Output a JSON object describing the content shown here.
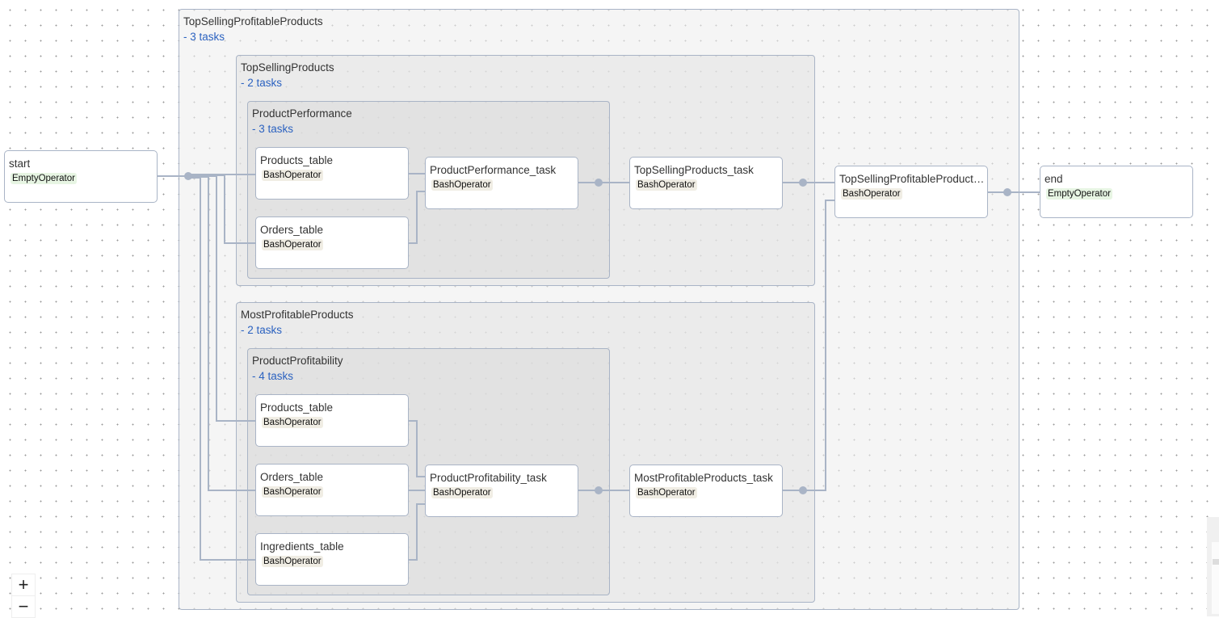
{
  "groups": {
    "top_selling_profitable": {
      "title": "TopSellingProfitableProducts",
      "count": "- 3 tasks"
    },
    "top_selling": {
      "title": "TopSellingProducts",
      "count": "- 2 tasks"
    },
    "product_performance": {
      "title": "ProductPerformance",
      "count": "- 3 tasks"
    },
    "most_profitable": {
      "title": "MostProfitableProducts",
      "count": "- 2 tasks"
    },
    "product_profitability": {
      "title": "ProductProfitability",
      "count": "- 4 tasks"
    }
  },
  "nodes": {
    "start": {
      "title": "start",
      "operator": "EmptyOperator"
    },
    "pp_products": {
      "title": "Products_table",
      "operator": "BashOperator"
    },
    "pp_orders": {
      "title": "Orders_table",
      "operator": "BashOperator"
    },
    "pp_task": {
      "title": "ProductPerformance_task",
      "operator": "BashOperator"
    },
    "tsp_task": {
      "title": "TopSellingProducts_task",
      "operator": "BashOperator"
    },
    "tspp_task": {
      "title": "TopSellingProfitableProduct…",
      "operator": "BashOperator"
    },
    "end": {
      "title": "end",
      "operator": "EmptyOperator"
    },
    "pf_products": {
      "title": "Products_table",
      "operator": "BashOperator"
    },
    "pf_orders": {
      "title": "Orders_table",
      "operator": "BashOperator"
    },
    "pf_ingredients": {
      "title": "Ingredients_table",
      "operator": "BashOperator"
    },
    "pf_task": {
      "title": "ProductProfitability_task",
      "operator": "BashOperator"
    },
    "mpp_task": {
      "title": "MostProfitableProducts_task",
      "operator": "BashOperator"
    }
  },
  "controls": {
    "zoom_in": "+",
    "zoom_out": "−"
  },
  "colors": {
    "edge": "#a9b4c6",
    "group_count": "#2b62c0",
    "bash_badge": "#f0ede4",
    "empty_badge": "#e7f5e3"
  }
}
